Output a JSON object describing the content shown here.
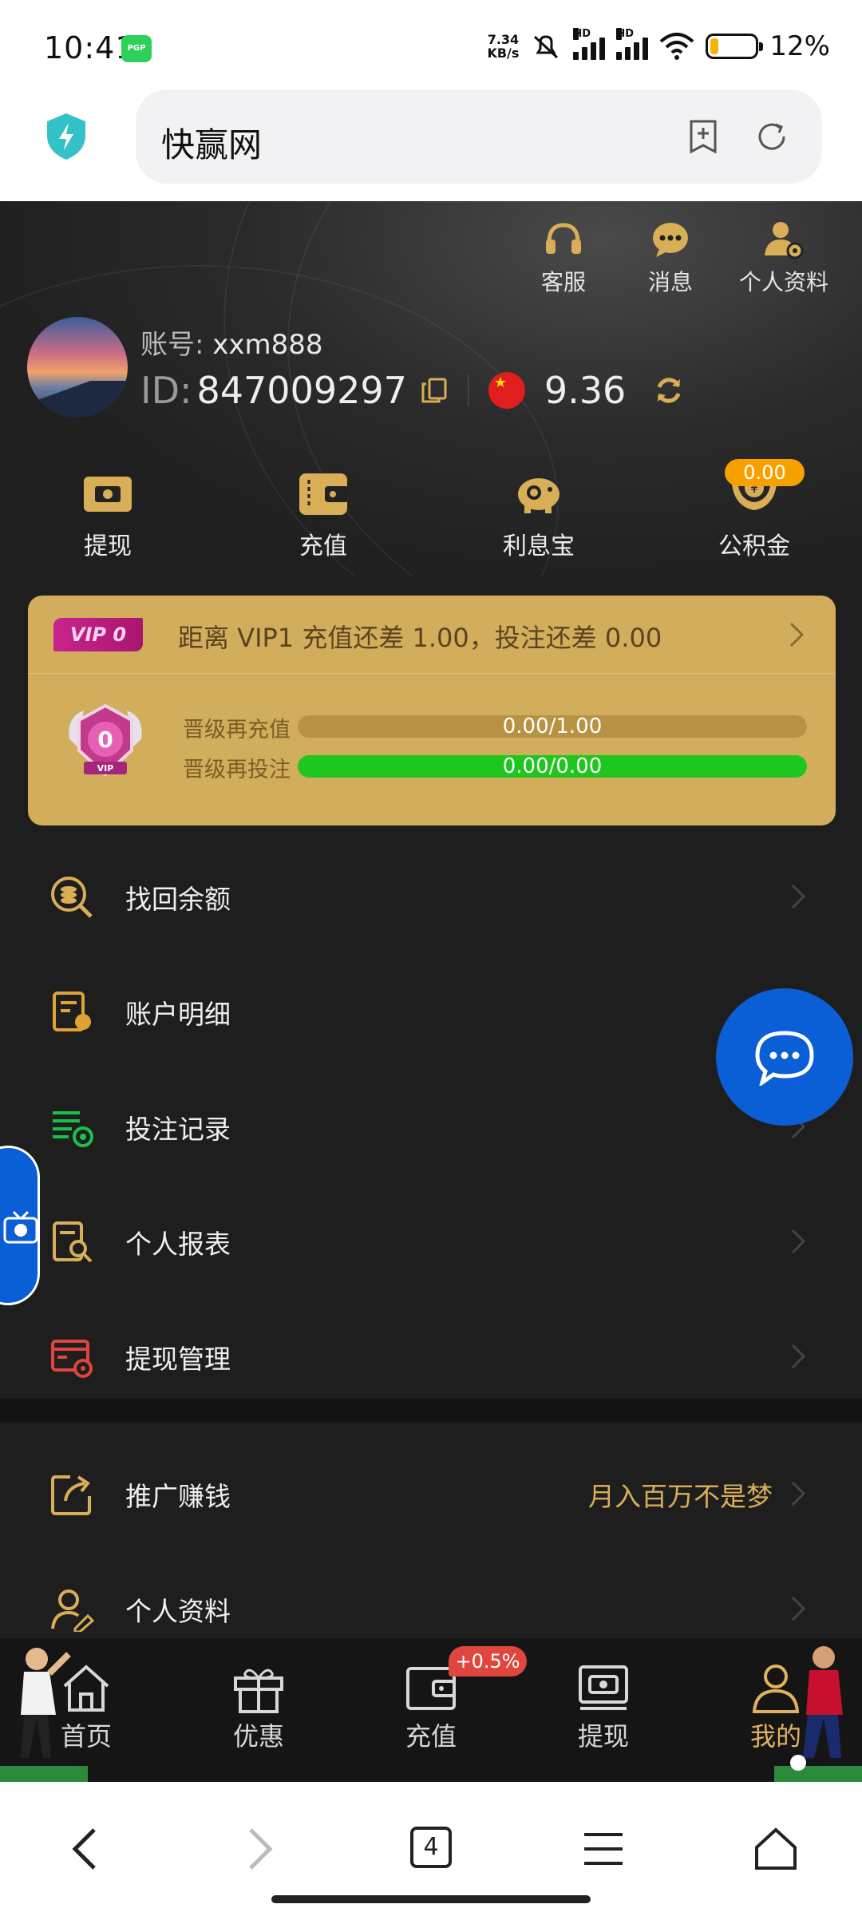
{
  "status_bar": {
    "time": "10:41",
    "app_badge": "PGP",
    "net_speed_value": "7.34",
    "net_speed_unit": "KB/s",
    "signal_label_1": "HD",
    "signal_label_2": "HD",
    "battery_percent": "12%",
    "battery_level": 0.12
  },
  "browser": {
    "url_title": "快赢网"
  },
  "header_actions": [
    {
      "label": "客服",
      "icon": "headset-icon"
    },
    {
      "label": "消息",
      "icon": "message-icon"
    },
    {
      "label": "个人资料",
      "icon": "user-settings-icon"
    }
  ],
  "profile": {
    "account_label": "账号:",
    "account_value": "xxm888",
    "id_label": "ID:",
    "id_value": "847009297",
    "balance": "9.36"
  },
  "quick_actions": [
    {
      "label": "提现",
      "icon": "withdraw-icon"
    },
    {
      "label": "充值",
      "icon": "wallet-icon"
    },
    {
      "label": "利息宝",
      "icon": "piggy-bank-icon"
    },
    {
      "label": "公积金",
      "icon": "fund-hands-icon",
      "badge": "0.00"
    }
  ],
  "vip": {
    "tag": "VIP 0",
    "summary": "距离 VIP1 充值还差 1.00，投注还差 0.00",
    "level_number": "0",
    "badge_text": "VIP",
    "recharge_label": "晋级再充值",
    "recharge_progress": "0.00/1.00",
    "recharge_fraction": 0,
    "bet_label": "晋级再投注",
    "bet_progress": "0.00/0.00",
    "bet_fraction": 1,
    "accent": "#d2ad5c"
  },
  "menu": [
    {
      "label": "找回余额",
      "icon": "search-coin-icon"
    },
    {
      "label": "账户明细",
      "icon": "account-detail-icon"
    },
    {
      "label": "投注记录",
      "icon": "bet-record-icon"
    },
    {
      "label": "个人报表",
      "icon": "report-search-icon"
    },
    {
      "label": "提现管理",
      "icon": "withdraw-manage-icon"
    }
  ],
  "menu2": [
    {
      "label": "推广赚钱",
      "icon": "share-icon",
      "extra": "月入百万不是梦"
    },
    {
      "label": "个人资料",
      "icon": "profile-edit-icon"
    }
  ],
  "tabbar": {
    "items": [
      {
        "label": "首页",
        "icon": "home-icon"
      },
      {
        "label": "优惠",
        "icon": "gift-icon"
      },
      {
        "label": "充值",
        "icon": "wallet-icon"
      },
      {
        "label": "提现",
        "icon": "withdraw-icon"
      },
      {
        "label": "我的",
        "icon": "user-icon",
        "active": true
      }
    ],
    "promo_badge": "+0.5%"
  },
  "system_nav": {
    "tabs_count": "4"
  }
}
